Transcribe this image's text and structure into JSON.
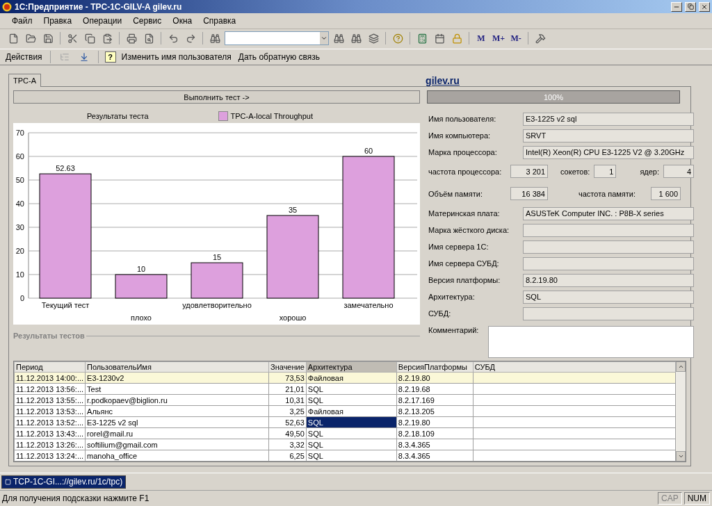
{
  "window": {
    "title": "1С:Предприятие - TPC-1C-GILV-A gilev.ru"
  },
  "menu": [
    {
      "label": "Файл"
    },
    {
      "label": "Правка"
    },
    {
      "label": "Операции"
    },
    {
      "label": "Сервис"
    },
    {
      "label": "Окна"
    },
    {
      "label": "Справка"
    }
  ],
  "toolbar": {
    "memory_buttons": [
      "M",
      "M+",
      "M-"
    ]
  },
  "form_toolbar": {
    "actions": "Действия",
    "help_glyph": "?",
    "buttons": [
      "Изменить имя пользователя",
      "Дать обратную связь"
    ]
  },
  "tabs": [
    {
      "label": "TPC-A",
      "selected": true
    }
  ],
  "site_link": "gilev.ru",
  "run_button": "Выполнить тест ->",
  "progress": {
    "level": 1,
    "reading": "100%"
  },
  "chart_data": {
    "type": "bar",
    "title": "Результаты теста",
    "categories": [
      "Текущий тест",
      "плохо",
      "удовлетворительно",
      "хорошо",
      "замечательно"
    ],
    "series": [
      {
        "name": "TPC-A-local Throughput",
        "color": "#dda0dd",
        "values": [
          52.63,
          10,
          15,
          35,
          60
        ]
      }
    ],
    "ylim": [
      0,
      70
    ],
    "yticks": [
      0,
      10,
      20,
      30,
      40,
      50,
      60,
      70
    ],
    "data_labels": true,
    "grid": true
  },
  "info": [
    {
      "kind": "field",
      "label": "Имя пользователя:",
      "value": "E3-1225 v2 sql"
    },
    {
      "kind": "field",
      "label": "Имя компьютера:",
      "value": "SRVT"
    },
    {
      "kind": "field",
      "label": "Марка процессора:",
      "value": "Intel(R) Xeon(R) CPU E3-1225 V2 @ 3.20GHz"
    },
    {
      "kind": "numbers",
      "items": [
        {
          "label": "частота процессора:",
          "value": "3 201"
        },
        {
          "label": "сокетов:",
          "value": "1"
        },
        {
          "label": "ядер:",
          "value": "4"
        }
      ]
    },
    {
      "kind": "numbers",
      "items": [
        {
          "label": "Объём памяти:",
          "value": "16 384"
        },
        {
          "label": "частота памяти:",
          "value": "1 600"
        }
      ]
    },
    {
      "kind": "field",
      "label": "Материнская плата:",
      "value": "ASUSTeK Computer INC. : P8B-X series"
    },
    {
      "kind": "field",
      "label": "Марка жёсткого диска:"
    },
    {
      "kind": "field",
      "label": "Имя сервера 1С:"
    },
    {
      "kind": "field",
      "label": "Имя сервера СУБД:"
    },
    {
      "kind": "field",
      "label": "Версия платформы:",
      "value": "8.2.19.80"
    },
    {
      "kind": "field",
      "label": "Архитектура:",
      "value": "SQL"
    },
    {
      "kind": "field",
      "label": "СУБД:"
    }
  ],
  "comment": {
    "label": "Комментарий:"
  },
  "results_group": "Результаты тестов",
  "table": {
    "columns": [
      {
        "label": "Период",
        "focused": false
      },
      {
        "label": "ПользовательИмя",
        "focused": false
      },
      {
        "label": "Значение",
        "focused": false
      },
      {
        "label": "Архитектура",
        "focused": true
      },
      {
        "label": "ВерсияПлатформы",
        "focused": false
      },
      {
        "label": "СУБД",
        "focused": false
      }
    ],
    "rows": [
      {
        "cells": [
          "11.12.2013 14:00:...",
          "E3-1230v2",
          "73,53",
          "Файловая",
          "8.2.19.80"
        ],
        "current": true,
        "selected": false
      },
      {
        "cells": [
          "11.12.2013 13:56:...",
          "Test",
          "21,01",
          "SQL",
          "8.2.19.68"
        ],
        "current": false,
        "selected": false
      },
      {
        "cells": [
          "11.12.2013 13:55:...",
          "r.podkopaev@biglion.ru",
          "10,31",
          "SQL",
          "8.2.17.169"
        ],
        "current": false,
        "selected": false
      },
      {
        "cells": [
          "11.12.2013 13:53:...",
          "Альянс",
          "3,25",
          "Файловая",
          "8.2.13.205"
        ],
        "current": false,
        "selected": false
      },
      {
        "cells": [
          "11.12.2013 13:52:...",
          "E3-1225 v2 sql",
          "52,63",
          "SQL",
          "8.2.19.80"
        ],
        "current": false,
        "selected": true
      },
      {
        "cells": [
          "11.12.2013 13:43:...",
          "rorel@mail.ru",
          "49,50",
          "SQL",
          "8.2.18.109"
        ],
        "current": false,
        "selected": false
      },
      {
        "cells": [
          "11.12.2013 13:26:...",
          "softilium@gmail.com",
          "3,32",
          "SQL",
          "8.3.4.365"
        ],
        "current": false,
        "selected": false
      },
      {
        "cells": [
          "11.12.2013 13:24:...",
          "manoha_office",
          "6,25",
          "SQL",
          "8.3.4.365"
        ],
        "current": false,
        "selected": false
      }
    ]
  },
  "window_tabs": [
    {
      "label": "TCP-1C-GI...://gilev.ru/1c/tpc)",
      "selected": true
    }
  ],
  "status_bar": {
    "hint": "Для получения подсказки нажмите F1",
    "indicators": [
      "CAP",
      "NUM"
    ]
  }
}
